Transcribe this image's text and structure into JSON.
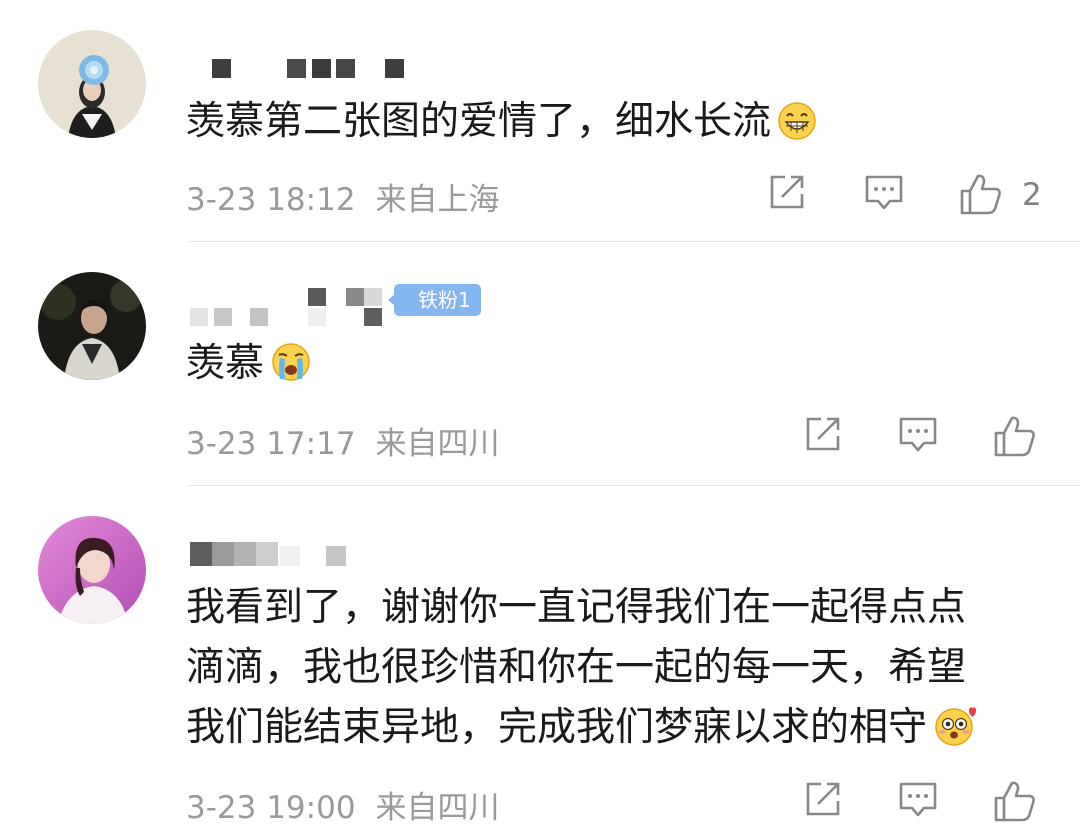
{
  "comments": [
    {
      "username": "",
      "text": "羡慕第二张图的爱情了，细水长流",
      "emoji": "grinning-face",
      "date": "3-23 18:12",
      "location": "来自上海",
      "like_count": "2",
      "badge": ""
    },
    {
      "username": "",
      "badge": "铁粉1",
      "text": "羡慕",
      "emoji": "crying-face",
      "date": "3-23 17:17",
      "location": "来自四川",
      "like_count": ""
    },
    {
      "username": "",
      "text_lines": [
        "我看到了，谢谢你一直记得我们在一起得点点",
        "滴滴，我也很珍惜和你在一起的每一天，希望",
        "我们能结束异地，完成我们梦寐以求的相守"
      ],
      "emoji": "heart-face",
      "date": "3-23 19:00",
      "location": "来自四川",
      "like_count": "",
      "badge": ""
    }
  ],
  "icons": {
    "share": "share-icon",
    "reply": "comment-icon",
    "like": "thumbs-up-icon"
  },
  "colors": {
    "text": "#1a1a1a",
    "meta": "#9a9a9a",
    "badge": "#84b6f0",
    "divider": "#e8e8e8"
  }
}
